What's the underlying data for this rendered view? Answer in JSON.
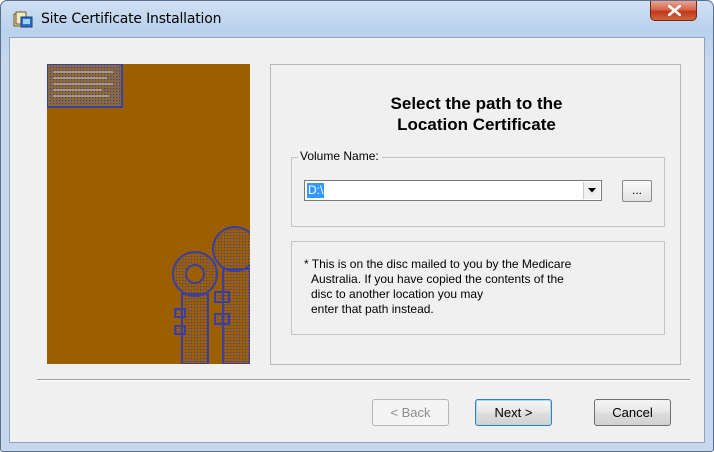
{
  "window": {
    "title": "Site Certificate Installation"
  },
  "titlebar": {
    "close_label": "X"
  },
  "main": {
    "heading_line1": "Select the path to the",
    "heading_line2": "Location Certificate",
    "volume_group_label": "Volume Name:",
    "volume_value": "D:\\",
    "browse_label": "...",
    "note_lines": [
      "* This is on the disc mailed to you by the Medicare",
      "Australia.  If you have copied the contents of the",
      "disc to another location you may",
      "enter that path instead."
    ]
  },
  "footer": {
    "back_label": "< Back",
    "next_label": "Next >",
    "cancel_label": "Cancel"
  },
  "icons": {
    "app": "installer-icon",
    "close": "close-icon",
    "dropdown": "chevron-down-icon"
  },
  "colors": {
    "sidebar_bg": "#9c5f00",
    "sidebar_art": "#3a3fa0",
    "close_button": "#c7472a"
  }
}
